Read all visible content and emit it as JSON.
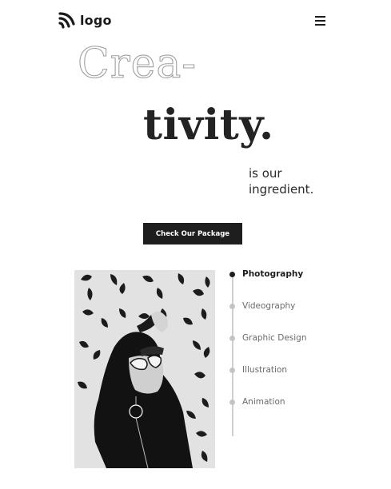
{
  "header": {
    "logo_text": "logo",
    "logo_icon": "logo-mark-icon",
    "menu_icon": "hamburger-icon"
  },
  "hero": {
    "line1": "Crea-",
    "line2": "tivity.",
    "tagline_line1": "is our",
    "tagline_line2": "ingredient."
  },
  "cta": {
    "label": "Check Our Package"
  },
  "services": [
    {
      "label": "Photography",
      "active": true
    },
    {
      "label": "Videography",
      "active": false
    },
    {
      "label": "Graphic Design",
      "active": false
    },
    {
      "label": "Illustration",
      "active": false
    },
    {
      "label": "Animation",
      "active": false
    }
  ],
  "colors": {
    "text": "#1b1b1b",
    "button_bg": "#1e1e1e",
    "rail": "#d0d0d0"
  }
}
